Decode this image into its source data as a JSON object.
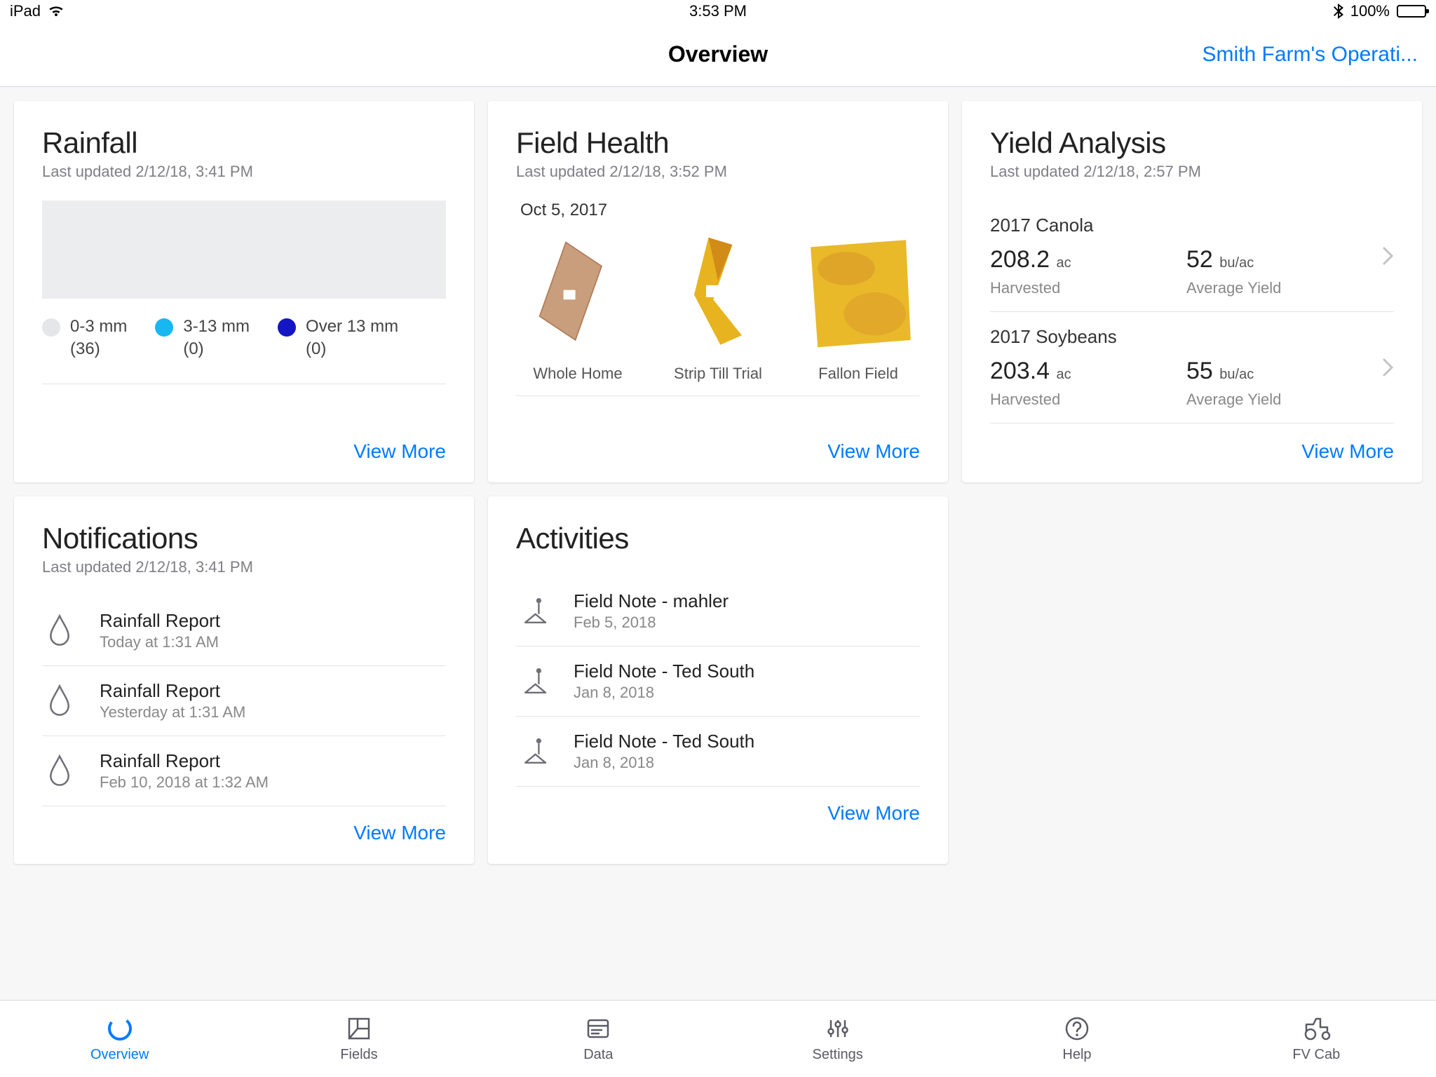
{
  "status_bar": {
    "device": "iPad",
    "time": "3:53 PM",
    "battery_pct": "100%"
  },
  "header": {
    "title": "Overview",
    "right_label": "Smith Farm's Operati..."
  },
  "cards": {
    "rainfall": {
      "title": "Rainfall",
      "sub": "Last updated 2/12/18, 3:41 PM",
      "legend": [
        {
          "color": "#e4e6e9",
          "label": "0-3 mm",
          "count": "(36)"
        },
        {
          "color": "#18b7f2",
          "label": "3-13 mm",
          "count": "(0)"
        },
        {
          "color": "#1416c5",
          "label": "Over 13 mm",
          "count": "(0)"
        }
      ],
      "view_more": "View More"
    },
    "field_health": {
      "title": "Field Health",
      "sub": "Last updated 2/12/18, 3:52 PM",
      "date": "Oct 5, 2017",
      "thumbs": [
        {
          "name": "Whole Home"
        },
        {
          "name": "Strip Till Trial"
        },
        {
          "name": "Fallon Field"
        }
      ],
      "view_more": "View More"
    },
    "yield": {
      "title": "Yield Analysis",
      "sub": "Last updated 2/12/18, 2:57 PM",
      "rows": [
        {
          "crop": "2017 Canola",
          "harvested_val": "208.2",
          "harvested_unit": "ac",
          "harvested_lbl": "Harvested",
          "avg_val": "52",
          "avg_unit": "bu/ac",
          "avg_lbl": "Average Yield"
        },
        {
          "crop": "2017 Soybeans",
          "harvested_val": "203.4",
          "harvested_unit": "ac",
          "harvested_lbl": "Harvested",
          "avg_val": "55",
          "avg_unit": "bu/ac",
          "avg_lbl": "Average Yield"
        }
      ],
      "view_more": "View More"
    },
    "notifications": {
      "title": "Notifications",
      "sub": "Last updated 2/12/18, 3:41 PM",
      "items": [
        {
          "title": "Rainfall Report",
          "sub": "Today at 1:31 AM"
        },
        {
          "title": "Rainfall Report",
          "sub": "Yesterday at 1:31 AM"
        },
        {
          "title": "Rainfall Report",
          "sub": "Feb 10, 2018 at 1:32 AM"
        }
      ],
      "view_more": "View More"
    },
    "activities": {
      "title": "Activities",
      "items": [
        {
          "title": "Field Note - mahler",
          "sub": "Feb 5, 2018"
        },
        {
          "title": "Field Note - Ted South",
          "sub": "Jan 8, 2018"
        },
        {
          "title": "Field Note - Ted South",
          "sub": "Jan 8, 2018"
        }
      ],
      "view_more": "View More"
    }
  },
  "tabs": [
    {
      "id": "overview",
      "label": "Overview",
      "active": true
    },
    {
      "id": "fields",
      "label": "Fields",
      "active": false
    },
    {
      "id": "data",
      "label": "Data",
      "active": false
    },
    {
      "id": "settings",
      "label": "Settings",
      "active": false
    },
    {
      "id": "help",
      "label": "Help",
      "active": false
    },
    {
      "id": "fvcab",
      "label": "FV Cab",
      "active": false
    }
  ]
}
